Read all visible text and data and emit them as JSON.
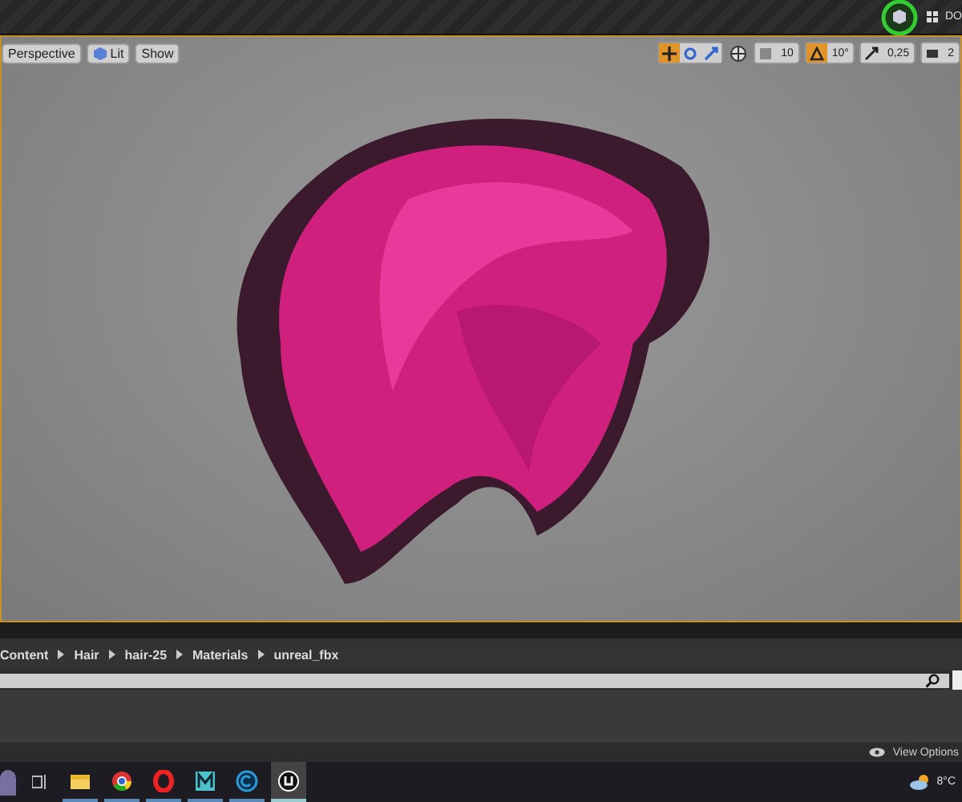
{
  "top_bar": {
    "label": "DO"
  },
  "viewport": {
    "buttons": [
      {
        "label": "Perspective"
      },
      {
        "label": "Lit"
      },
      {
        "label": "Show"
      }
    ],
    "transform_modes": [
      {
        "kind": "move",
        "selected": true
      },
      {
        "kind": "rotate",
        "selected": false
      },
      {
        "kind": "scale",
        "selected": false
      }
    ],
    "snaps": [
      {
        "kind": "grid",
        "on": false,
        "value": "10"
      },
      {
        "kind": "angle",
        "on": true,
        "value": "10°"
      },
      {
        "kind": "scale",
        "on": false,
        "value": "0,25"
      },
      {
        "kind": "camera",
        "on": false,
        "value": "2"
      }
    ]
  },
  "content_browser": {
    "breadcrumb": [
      "Content",
      "Hair",
      "hair-25",
      "Materials",
      "unreal_fbx"
    ],
    "view_options": "View Options"
  },
  "taskbar": {
    "apps": [
      {
        "kind": "explorer",
        "selected": false
      },
      {
        "kind": "chrome",
        "selected": false
      },
      {
        "kind": "opera",
        "selected": false
      },
      {
        "kind": "m",
        "selected": false
      },
      {
        "kind": "c",
        "selected": false
      },
      {
        "kind": "unreal",
        "selected": true
      }
    ],
    "weather": "8°C"
  }
}
